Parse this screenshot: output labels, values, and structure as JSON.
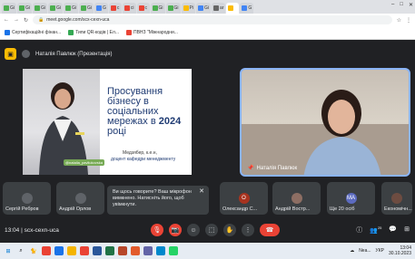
{
  "browser": {
    "tabs": [
      {
        "label": "Gi",
        "color": "#4caf50"
      },
      {
        "label": "Gi",
        "color": "#4caf50"
      },
      {
        "label": "Gi",
        "color": "#4caf50"
      },
      {
        "label": "Gi",
        "color": "#4caf50"
      },
      {
        "label": "Gi",
        "color": "#4caf50"
      },
      {
        "label": "Gi",
        "color": "#4caf50"
      },
      {
        "label": "G",
        "color": "#4285f4"
      },
      {
        "label": "c",
        "color": "#ea4335"
      },
      {
        "label": "ci",
        "color": "#ea4335"
      },
      {
        "label": "c",
        "color": "#ea4335"
      },
      {
        "label": "Gi",
        "color": "#4caf50"
      },
      {
        "label": "Gi",
        "color": "#4caf50"
      },
      {
        "label": "Pi",
        "color": "#fbbc04"
      },
      {
        "label": "Gi",
        "color": "#4285f4"
      },
      {
        "label": "ar",
        "color": "#666"
      },
      {
        "label": "",
        "color": "#fbbc04",
        "active": true
      },
      {
        "label": "G",
        "color": "#4285f4"
      }
    ],
    "window_controls": [
      "–",
      "□",
      "✕"
    ],
    "url": "meet.google.com/scx-cexn-uca",
    "bookmarks": [
      "Сертифікаційні фінан...",
      "Типи QR-кодів | Ел...",
      "ПВНЗ \"Міжнародни..."
    ]
  },
  "meet": {
    "presenter_title": "Наталія Павлюк (Презентація)",
    "slide": {
      "title_lines": [
        "Просування",
        "бізнесу в",
        "соціальних",
        "мережах в"
      ],
      "title_year": "2024",
      "title_end": "році",
      "author": "Медзябер, к.е.н,",
      "position": "доцент кафедри менеджменту",
      "nick": "@natalia_pavliukovska"
    },
    "camera_name": "Наталія Павлюк",
    "participants": [
      {
        "name": "Сергій Ребров",
        "initial": "",
        "color": "#5f6368"
      },
      {
        "name": "Андрій Орлов",
        "initial": "",
        "color": "#5f6368"
      },
      {
        "name": "Олександр С...",
        "initial": "О",
        "color": "#a8331f"
      },
      {
        "name": "Андрій Востр...",
        "initial": "",
        "color": "#8d6e63"
      },
      {
        "name": "Ще 20 осіб",
        "initial": "МА",
        "color": "#5c6bc0"
      },
      {
        "name": "Економічн...",
        "initial": "",
        "color": "#6d4c41"
      }
    ],
    "toast": {
      "text": "Ви щось говорите? Ваш мікрофон вимкнено. Натисніть його, щоб увімкнути.",
      "close": "✕"
    },
    "time": "13:04",
    "separator": "|",
    "meeting_code": "scx-cexn-uca",
    "participant_count": "25"
  },
  "taskbar": {
    "weather": "Nea...",
    "lang": "УКР",
    "clock_time": "13:04",
    "clock_date": "30.10.2023"
  }
}
